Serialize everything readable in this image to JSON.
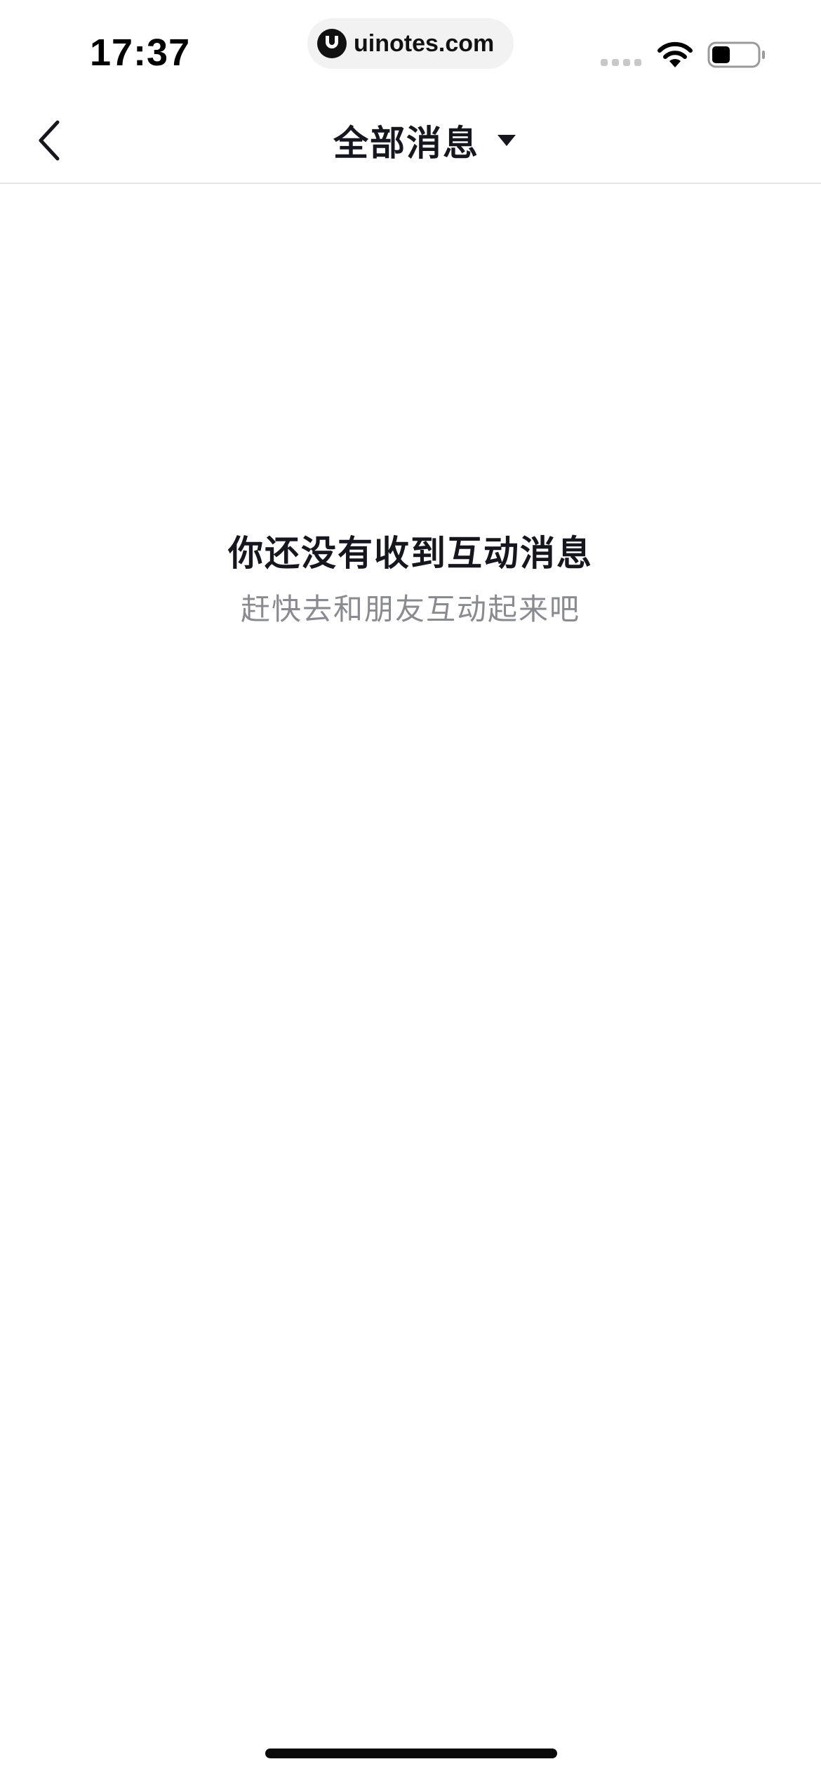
{
  "status_bar": {
    "time": "17:37",
    "watermark": "uinotes.com"
  },
  "nav": {
    "title": "全部消息"
  },
  "empty_state": {
    "title": "你还没有收到互动消息",
    "subtitle": "赶快去和朋友互动起来吧"
  },
  "icons": {
    "back": "chevron-left-icon",
    "dropdown": "caret-down-icon",
    "wifi": "wifi-icon",
    "battery": "battery-icon",
    "signal": "cellular-signal-icon"
  },
  "battery_level": 0.4,
  "colors": {
    "text_primary": "#16161e",
    "text_secondary": "#8a8b91",
    "divider": "#e6e6e6",
    "background": "#ffffff"
  }
}
